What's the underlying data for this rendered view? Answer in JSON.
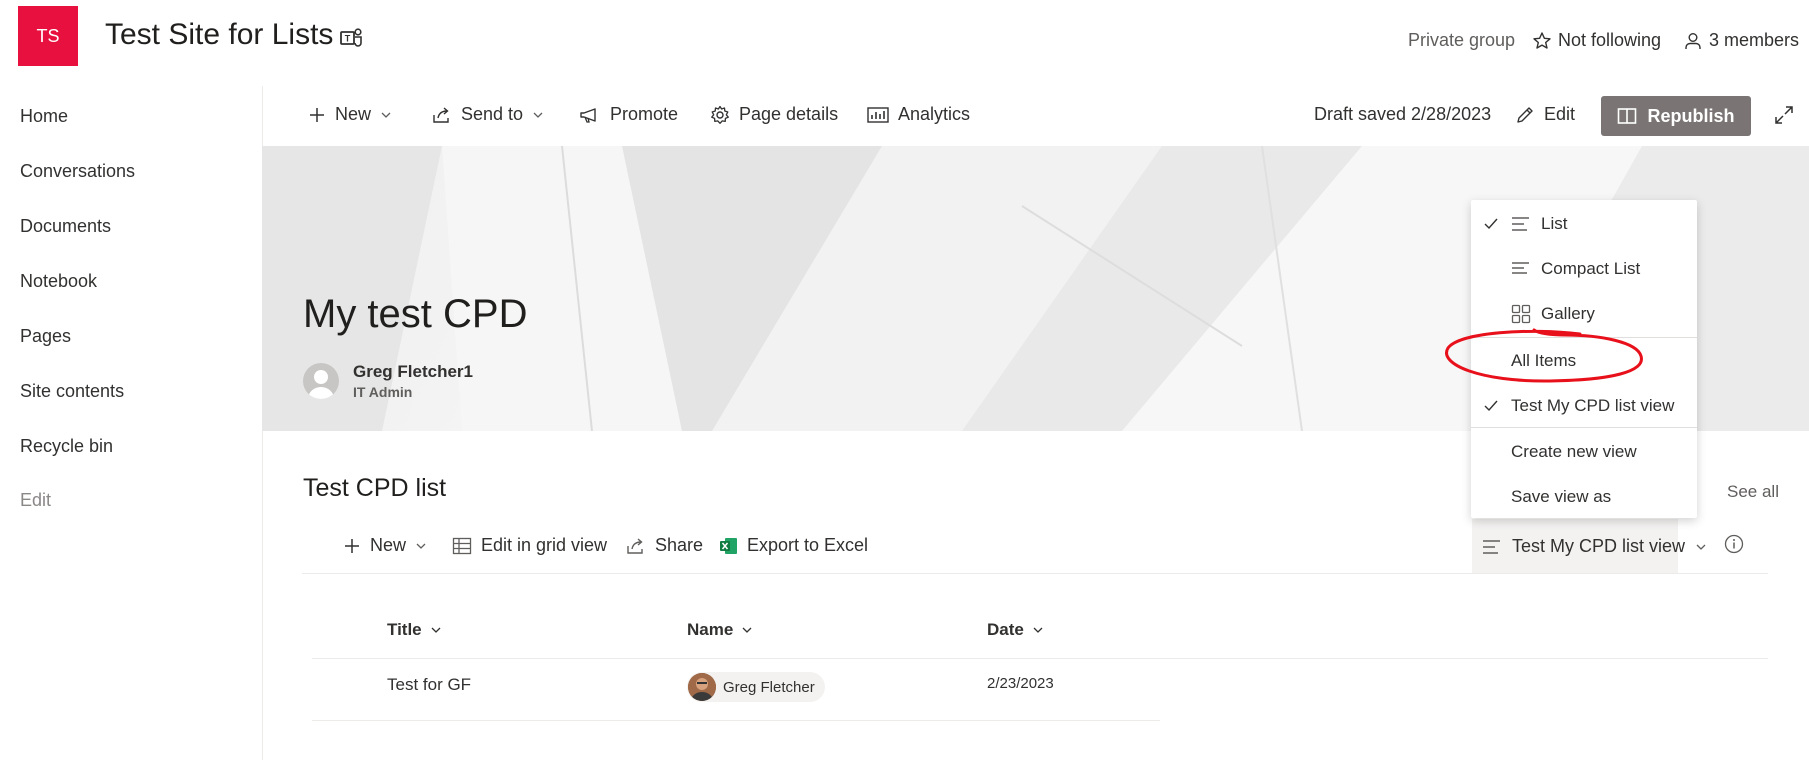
{
  "site": {
    "logo_text": "TS",
    "logo_color": "#e8103f",
    "title": "Test Site for Lists",
    "privacy": "Private group",
    "follow_label": "Not following",
    "members_label": "3 members"
  },
  "nav": {
    "items": [
      "Home",
      "Conversations",
      "Documents",
      "Notebook",
      "Pages",
      "Site contents",
      "Recycle bin"
    ],
    "edit_label": "Edit"
  },
  "command_bar": {
    "new_label": "New",
    "send_to_label": "Send to",
    "promote_label": "Promote",
    "page_details_label": "Page details",
    "analytics_label": "Analytics",
    "draft_status": "Draft saved 2/28/2023",
    "edit_label": "Edit",
    "republish_label": "Republish"
  },
  "hero": {
    "title": "My test CPD",
    "author_name": "Greg Fletcher1",
    "author_role": "IT Admin"
  },
  "list": {
    "title": "Test CPD list",
    "see_all": "See all",
    "commands": {
      "new": "New",
      "edit_grid": "Edit in grid view",
      "share": "Share",
      "export": "Export to Excel"
    },
    "current_view": "Test My CPD list view",
    "columns": [
      "Title",
      "Name",
      "Date"
    ],
    "rows": [
      {
        "title": "Test for GF",
        "name": "Greg Fletcher",
        "date": "2/23/2023"
      }
    ]
  },
  "view_menu": {
    "layouts": [
      {
        "label": "List",
        "icon": "list-icon",
        "checked": true
      },
      {
        "label": "Compact List",
        "icon": "compact-list-icon",
        "checked": false
      },
      {
        "label": "Gallery",
        "icon": "gallery-icon",
        "checked": false
      }
    ],
    "views": [
      {
        "label": "All Items",
        "checked": false,
        "highlighted": true
      },
      {
        "label": "Test My CPD list view",
        "checked": true,
        "highlighted": false
      }
    ],
    "actions": [
      "Create new view",
      "Save view as"
    ]
  },
  "colors": {
    "accent_logo": "#e8103f",
    "republish_bg": "#7a7574",
    "annotation": "#e8101a",
    "excel_green": "#107c41"
  }
}
